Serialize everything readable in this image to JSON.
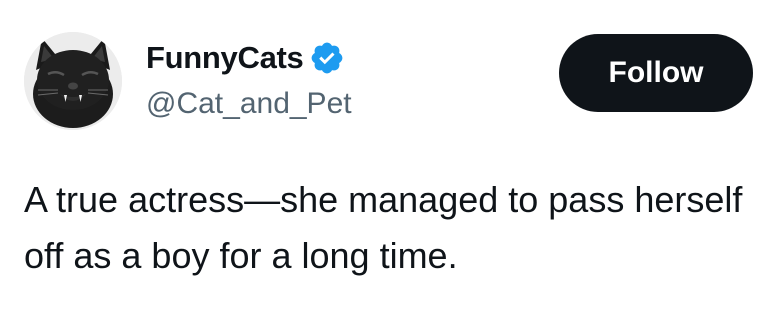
{
  "author": {
    "display_name": "FunnyCats",
    "handle": "@Cat_and_Pet",
    "verified": true,
    "avatar_icon": "black-cat-avatar"
  },
  "follow_button": {
    "label": "Follow"
  },
  "tweet": {
    "text": "A true actress—she managed to pass herself off as a boy for a long time."
  },
  "colors": {
    "text_primary": "#0f1419",
    "text_secondary": "#536471",
    "verified_blue": "#1d9bf0",
    "button_bg": "#0f1419",
    "button_text": "#ffffff"
  }
}
